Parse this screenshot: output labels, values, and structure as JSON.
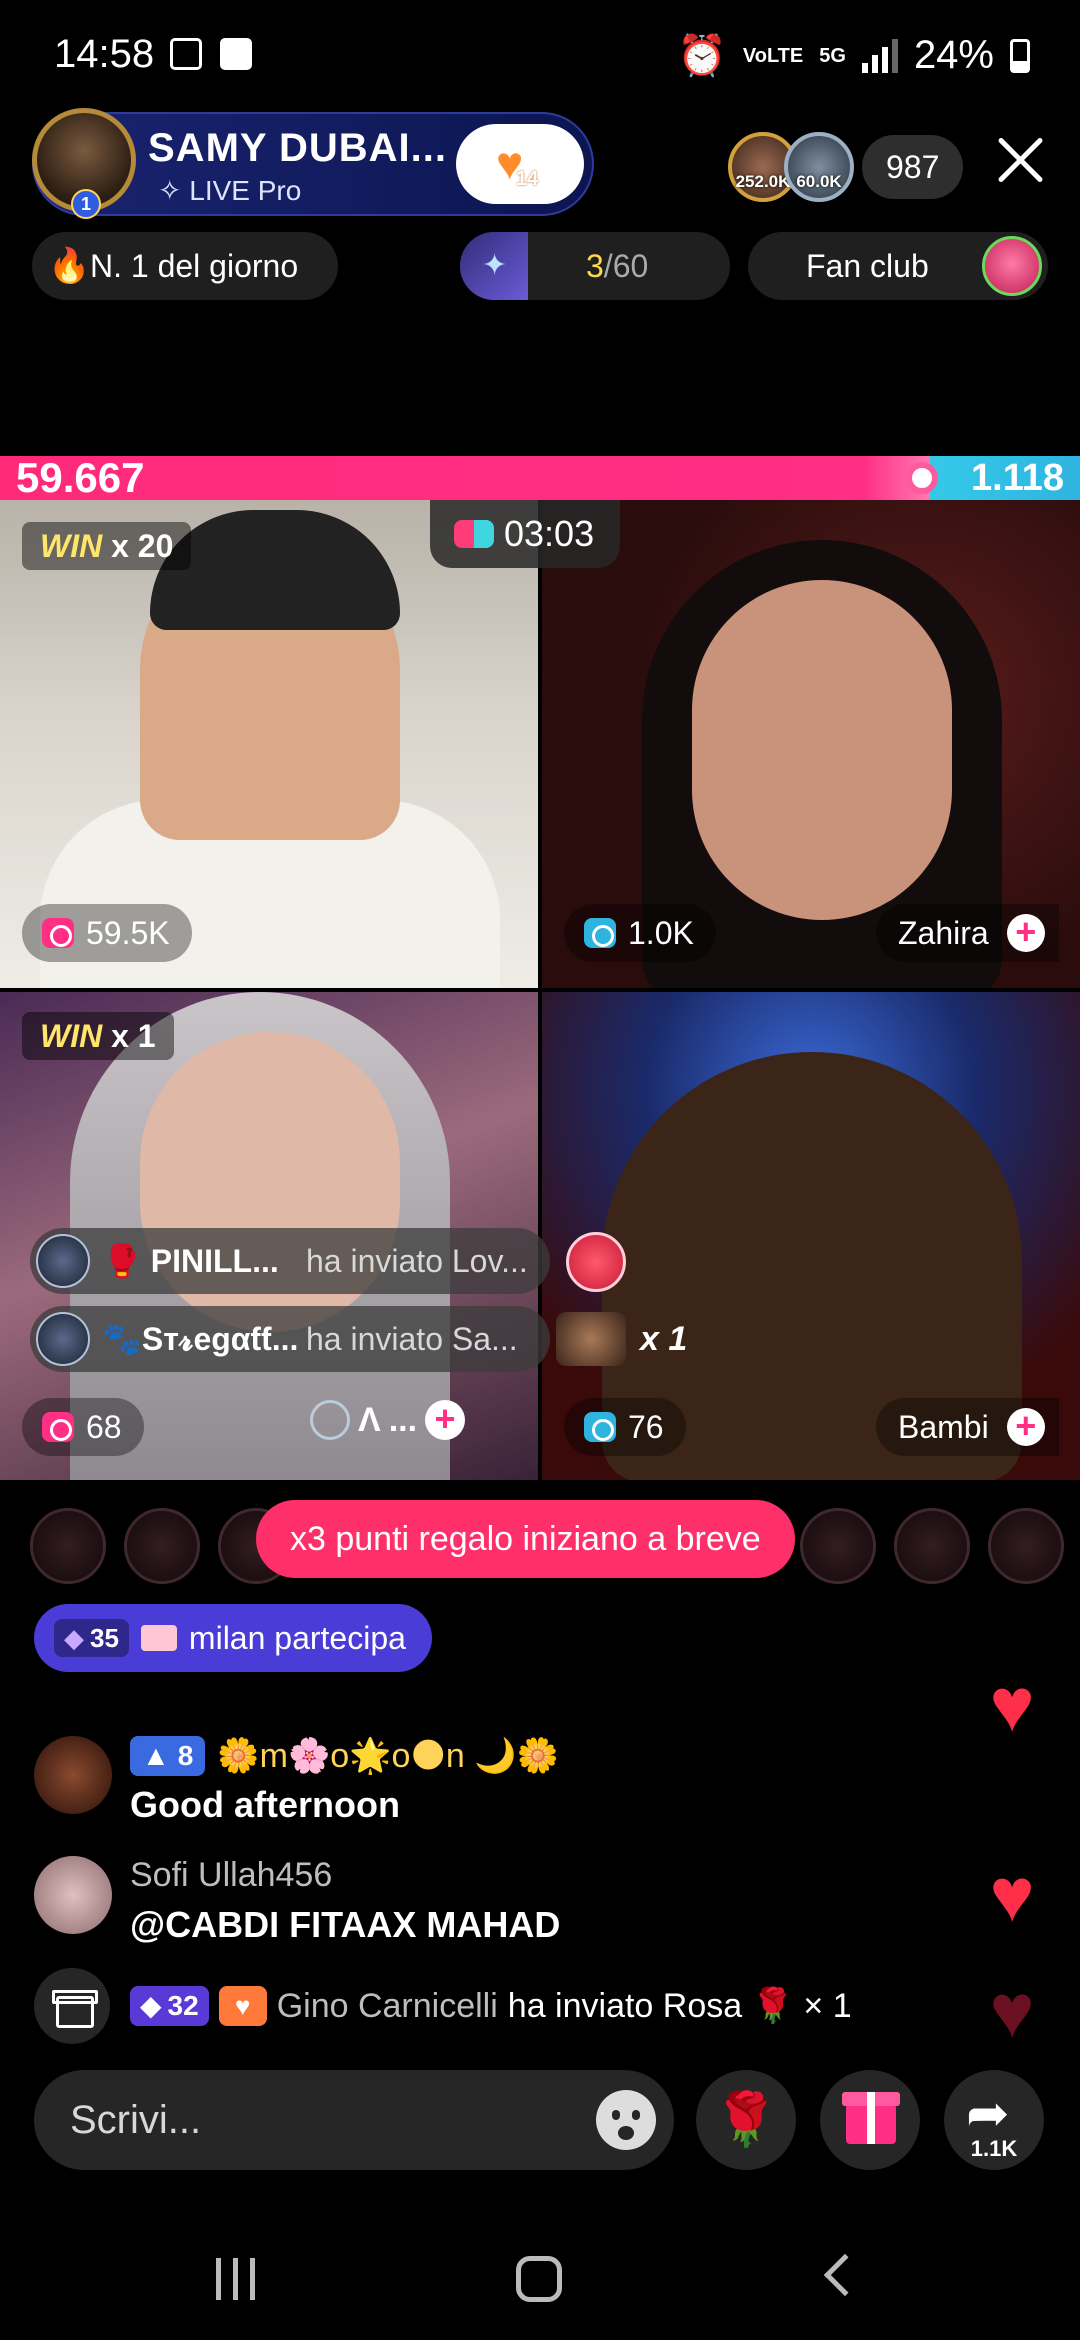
{
  "status_bar": {
    "time": "14:58",
    "network": "5G",
    "volte": "VoLTE",
    "battery": "24%",
    "icons": [
      "screenshot-icon",
      "check-box-icon",
      "alarm-icon",
      "signal-icon",
      "battery-icon"
    ]
  },
  "host": {
    "name": "SAMY DUBAI...",
    "subtitle": "✧ LIVE Pro",
    "level": "1",
    "like_count": "14"
  },
  "viewers": {
    "top1_score": "252.0K",
    "top2_score": "60.0K",
    "count": "987"
  },
  "chips": {
    "rank": "N. 1 del giorno",
    "progress_current": "3",
    "progress_total": "/60",
    "fan_club": "Fan club"
  },
  "pk": {
    "left_score": "59.667",
    "right_score": "1.118",
    "left_share": 0.98,
    "timer": "03:03"
  },
  "tiles": [
    {
      "win_label": "WIN",
      "win_mult": "x 20",
      "score": "59.5K",
      "name": ""
    },
    {
      "score": "1.0K",
      "name": "Zahira"
    },
    {
      "win_label": "WIN",
      "win_mult": "x 1",
      "score": "68",
      "name": "..."
    },
    {
      "score": "76",
      "name": "Bambi"
    }
  ],
  "gift_lines": [
    {
      "user": "🥊 PINILL...",
      "text": "ha inviato Lov..."
    },
    {
      "user": "🐾Sт𝓻egαƭƭ...",
      "text": "ha inviato Sa..."
    }
  ],
  "gift_combo": "x 1",
  "toast": "x3 punti regalo iniziano a breve",
  "join": {
    "level": "35",
    "text": "milan partecipa"
  },
  "chat": [
    {
      "user": "🌼m🌸o🌟o🌑n 🌙🌼",
      "level": "8",
      "message": "Good afternoon"
    },
    {
      "user": "Sofi Ullah456",
      "level": "",
      "message": "@CABDI FITAAX MAHAD"
    }
  ],
  "gift_message": {
    "level": "32",
    "user": "Gino Carnicelli",
    "text": "ha inviato Rosa 🌹 × 1"
  },
  "input": {
    "placeholder": "Scrivi..."
  },
  "share_count": "1.1K",
  "colors": {
    "pink": "#ff2f86",
    "blue": "#2fb4e0",
    "purple": "#4a3cd6"
  }
}
